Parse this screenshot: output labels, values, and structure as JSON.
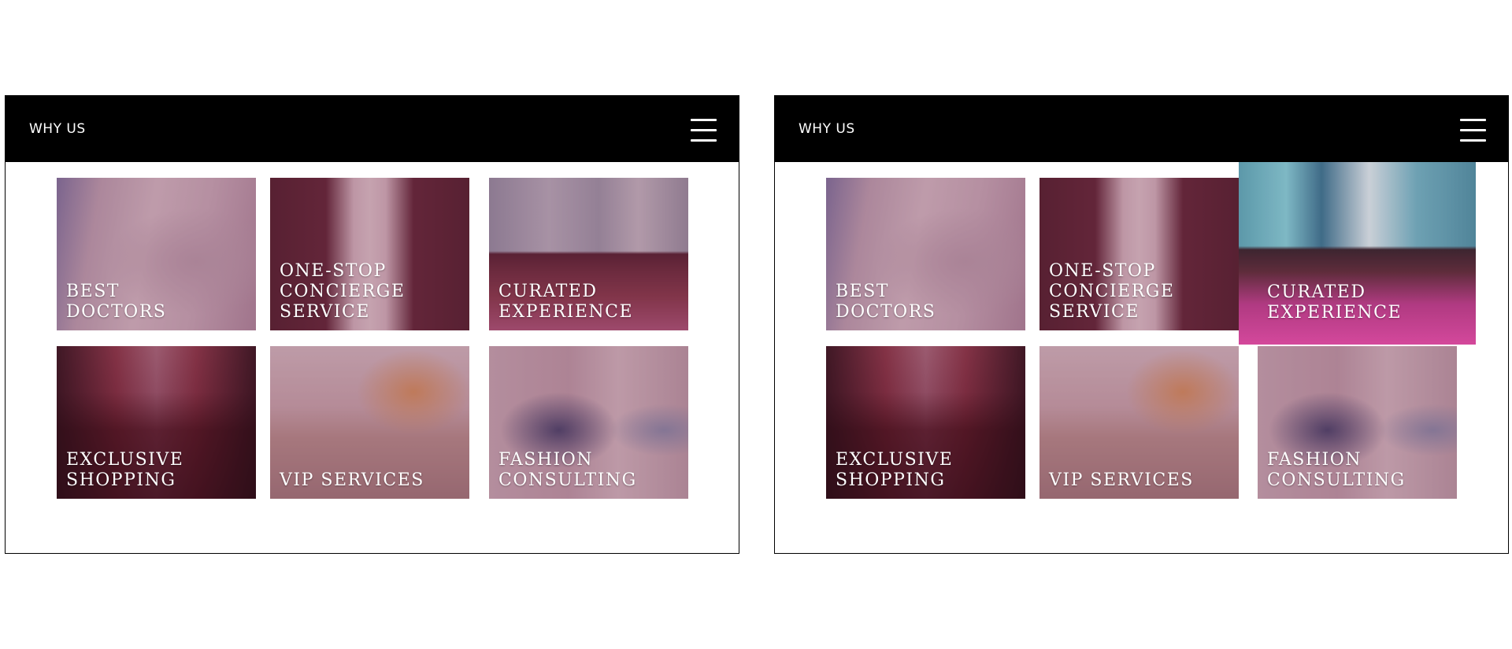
{
  "screens": [
    {
      "header": {
        "title": "WHY US",
        "menu_icon": "hamburger-menu-icon"
      },
      "tiles": [
        {
          "label": "BEST\nDOCTORS",
          "image": "doctor-photo"
        },
        {
          "label": "ONE-STOP\nCONCIERGE\nSERVICE",
          "image": "tuxedo-photo"
        },
        {
          "label": "CURATED\nEXPERIENCE",
          "image": "temple-photo"
        },
        {
          "label": "EXCLUSIVE\nSHOPPING",
          "image": "shopping-street-photo"
        },
        {
          "label": "VIP SERVICES",
          "image": "vip-lounge-photo"
        },
        {
          "label": "FASHION\nCONSULTING",
          "image": "fashion-store-photo"
        }
      ]
    },
    {
      "header": {
        "title": "WHY US",
        "menu_icon": "hamburger-menu-icon"
      },
      "hovered_tile": "CURATED\nEXPERIENCE",
      "tiles": [
        {
          "label": "BEST\nDOCTORS",
          "image": "doctor-photo"
        },
        {
          "label": "ONE-STOP\nCONCIERGE\nSERVICE",
          "image": "tuxedo-photo"
        },
        {
          "label": "CURATED\nEXPERIENCE",
          "image": "temple-photo"
        },
        {
          "label": "EXCLUSIVE\nSHOPPING",
          "image": "shopping-street-photo"
        },
        {
          "label": "VIP SERVICES",
          "image": "vip-lounge-photo"
        },
        {
          "label": "FASHION\nCONSULTING",
          "image": "fashion-store-photo"
        }
      ]
    }
  ],
  "colors": {
    "header_background": "#000000",
    "header_text": "#ffffff",
    "tile_overlay": "#742640",
    "page_background": "#ffffff"
  }
}
